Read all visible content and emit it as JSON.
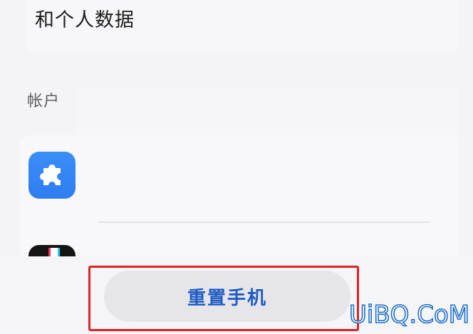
{
  "header": {
    "title_fragment": "和个人数据"
  },
  "accounts": {
    "section_label": "帐户",
    "apps": [
      {
        "icon": "puzzle-icon",
        "color": "#3a8ef8"
      },
      {
        "icon": "music-note-icon",
        "color": "#141414"
      }
    ]
  },
  "actions": {
    "reset_label": "重置手机",
    "reset_color": "#1f5bc4"
  },
  "annotation": {
    "highlight_color": "#e02226"
  },
  "watermark": {
    "text": "UiBQ.CoM",
    "color": "#1f6fc7"
  }
}
